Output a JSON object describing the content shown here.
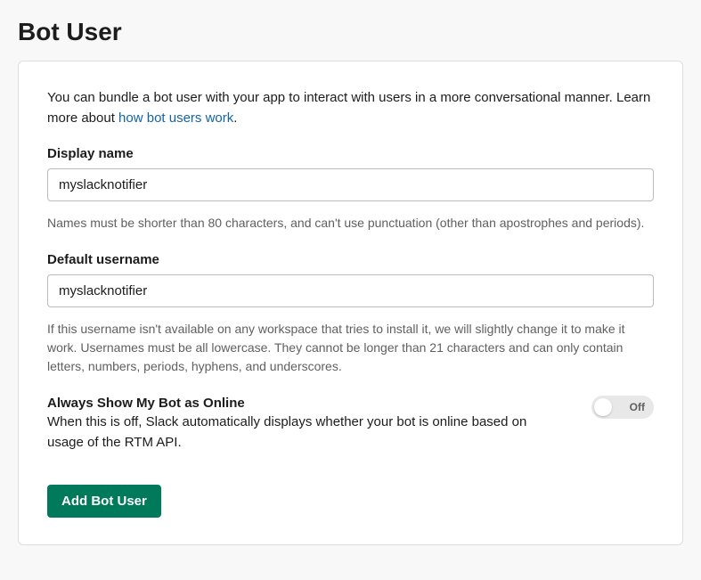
{
  "header": {
    "title": "Bot User"
  },
  "intro": {
    "text_prefix": "You can bundle a bot user with your app to interact with users in a more conversational manner. Learn more about ",
    "link_text": "how bot users work",
    "text_suffix": "."
  },
  "display_name": {
    "label": "Display name",
    "value": "myslacknotifier",
    "hint": "Names must be shorter than 80 characters, and can't use punctuation (other than apostrophes and periods)."
  },
  "default_username": {
    "label": "Default username",
    "value": "myslacknotifier",
    "hint": "If this username isn't available on any workspace that tries to install it, we will slightly change it to make it work. Usernames must be all lowercase. They cannot be longer than 21 characters and can only contain letters, numbers, periods, hyphens, and underscores."
  },
  "always_online": {
    "label": "Always Show My Bot as Online",
    "description": "When this is off, Slack automatically displays whether your bot is online based on usage of the RTM API.",
    "state": "Off"
  },
  "actions": {
    "add_bot_label": "Add Bot User"
  }
}
